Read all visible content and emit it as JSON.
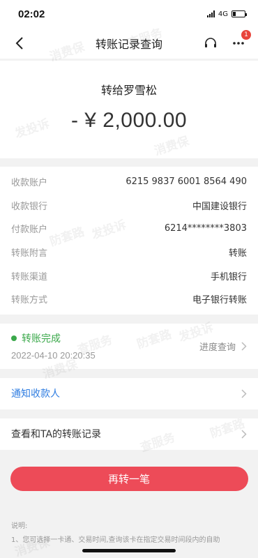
{
  "status_bar": {
    "time": "02:02",
    "network": "4G"
  },
  "nav": {
    "title": "转账记录查询",
    "badge": "1"
  },
  "transfer": {
    "payee_line": "转给罗雪松",
    "amount": "- ¥ 2,000.00"
  },
  "details": [
    {
      "label": "收款账户",
      "value": "6215 9837 6001 8564 490"
    },
    {
      "label": "收款银行",
      "value": "中国建设银行"
    },
    {
      "label": "付款账户",
      "value": "6214********3803"
    },
    {
      "label": "转账附言",
      "value": "转账"
    },
    {
      "label": "转账渠道",
      "value": "手机银行"
    },
    {
      "label": "转账方式",
      "value": "电子银行转账"
    }
  ],
  "status": {
    "title": "转账完成",
    "time": "2022-04-10 20:20:35",
    "progress_label": "进度查询"
  },
  "notify_label": "通知收款人",
  "history_label": "查看和TA的转账记录",
  "primary_button": "再转一笔",
  "notes": {
    "heading": "说明:",
    "line1": "1、您可选择一卡通、交易时间,查询该卡在指定交易时间段内的自助"
  },
  "watermark": [
    "消费保",
    "查服务",
    "防套路",
    "发投诉"
  ],
  "colors": {
    "success": "#3aa84a",
    "link": "#2f7de1",
    "primary": "#ed4b58",
    "badge": "#e8453c"
  }
}
